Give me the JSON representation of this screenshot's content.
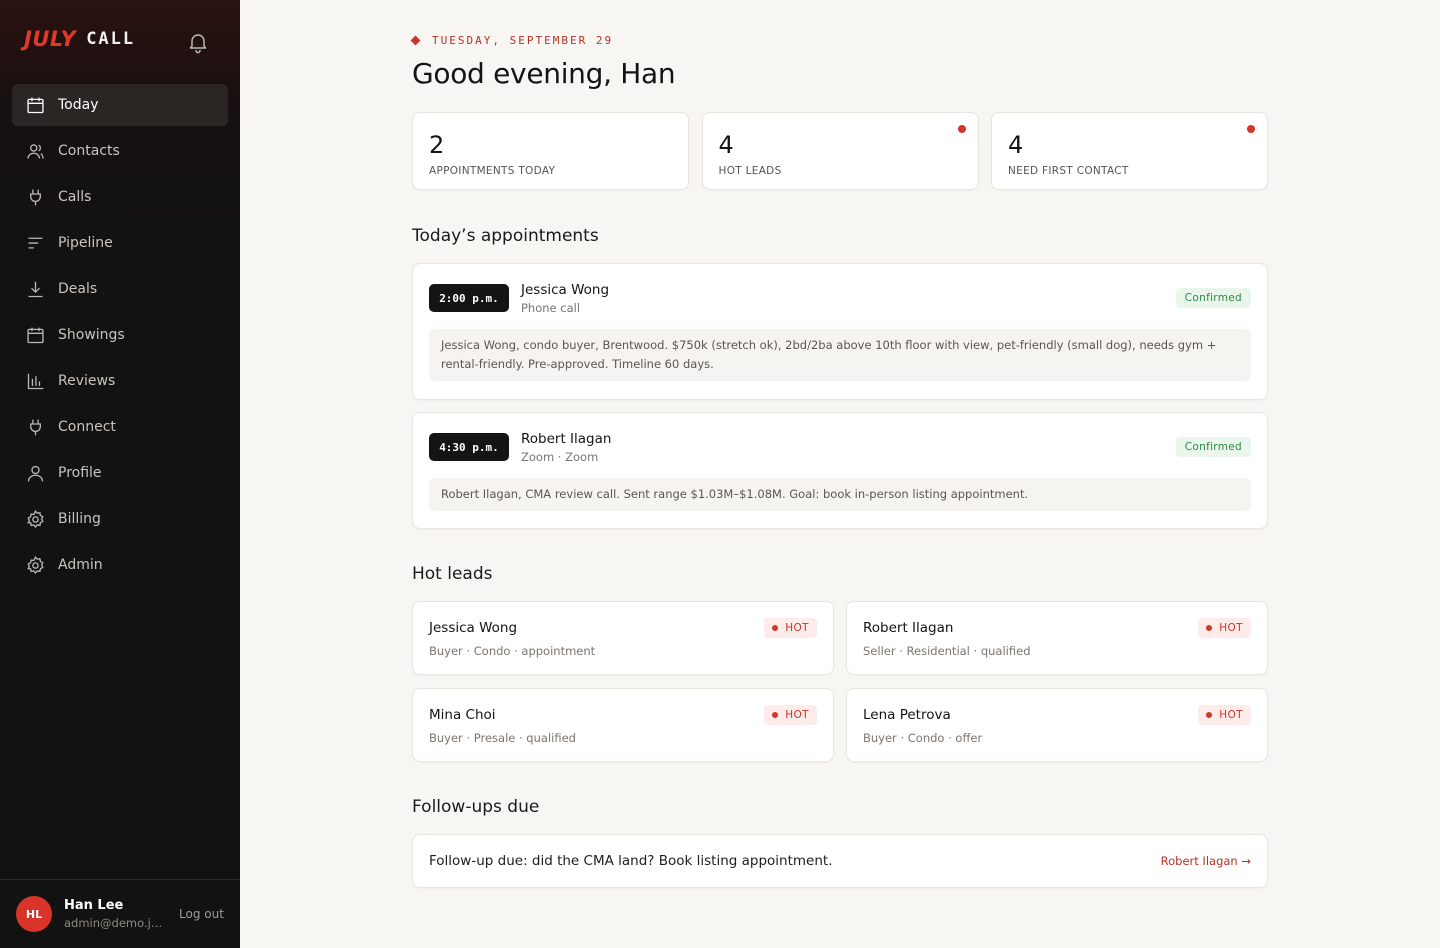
{
  "brand": {
    "part1": "JULY",
    "part2": "CALL"
  },
  "sidebar": {
    "items": [
      {
        "label": "Today",
        "icon": "calendar-icon",
        "active": true
      },
      {
        "label": "Contacts",
        "icon": "users-icon"
      },
      {
        "label": "Calls",
        "icon": "plug-icon"
      },
      {
        "label": "Pipeline",
        "icon": "pipeline-icon"
      },
      {
        "label": "Deals",
        "icon": "download-icon"
      },
      {
        "label": "Showings",
        "icon": "calendar-icon"
      },
      {
        "label": "Reviews",
        "icon": "bar-chart-icon"
      },
      {
        "label": "Connect",
        "icon": "plug-icon"
      },
      {
        "label": "Profile",
        "icon": "user-icon"
      },
      {
        "label": "Billing",
        "icon": "gear-icon"
      },
      {
        "label": "Admin",
        "icon": "gear-icon"
      }
    ],
    "user": {
      "initials": "HL",
      "name": "Han Lee",
      "email": "admin@demo.ju...",
      "logout": "Log out"
    }
  },
  "header": {
    "date": "TUESDAY, SEPTEMBER 29",
    "greeting": "Good evening, Han"
  },
  "stats": [
    {
      "value": "2",
      "label": "APPOINTMENTS TODAY",
      "alert": false
    },
    {
      "value": "4",
      "label": "HOT LEADS",
      "alert": true
    },
    {
      "value": "4",
      "label": "NEED FIRST CONTACT",
      "alert": true
    }
  ],
  "appointments": {
    "title": "Today’s appointments",
    "items": [
      {
        "time": "2:00 p.m.",
        "name": "Jessica Wong",
        "type": "Phone call",
        "status": "Confirmed",
        "notes": "Jessica Wong, condo buyer, Brentwood. $750k (stretch ok), 2bd/2ba above 10th floor with view, pet-friendly (small dog), needs gym + rental-friendly. Pre-approved. Timeline 60 days."
      },
      {
        "time": "4:30 p.m.",
        "name": "Robert Ilagan",
        "type": "Zoom · Zoom",
        "status": "Confirmed",
        "notes": "Robert Ilagan, CMA review call. Sent range $1.03M–$1.08M. Goal: book in-person listing appointment."
      }
    ]
  },
  "hot_leads": {
    "title": "Hot leads",
    "badge": "HOT",
    "items": [
      {
        "name": "Jessica Wong",
        "meta": "Buyer · Condo · appointment"
      },
      {
        "name": "Robert Ilagan",
        "meta": "Seller · Residential · qualified"
      },
      {
        "name": "Mina Choi",
        "meta": "Buyer · Presale · qualified"
      },
      {
        "name": "Lena Petrova",
        "meta": "Buyer · Condo · offer"
      }
    ]
  },
  "followups": {
    "title": "Follow-ups due",
    "items": [
      {
        "text": "Follow-up due: did the CMA land? Book listing appointment.",
        "link": "Robert Ilagan →"
      }
    ]
  },
  "colors": {
    "accent": "#d4352a",
    "sidebar_bg": "#121212",
    "page_bg": "#f8f6f3",
    "confirmed": "#2d8a45"
  }
}
